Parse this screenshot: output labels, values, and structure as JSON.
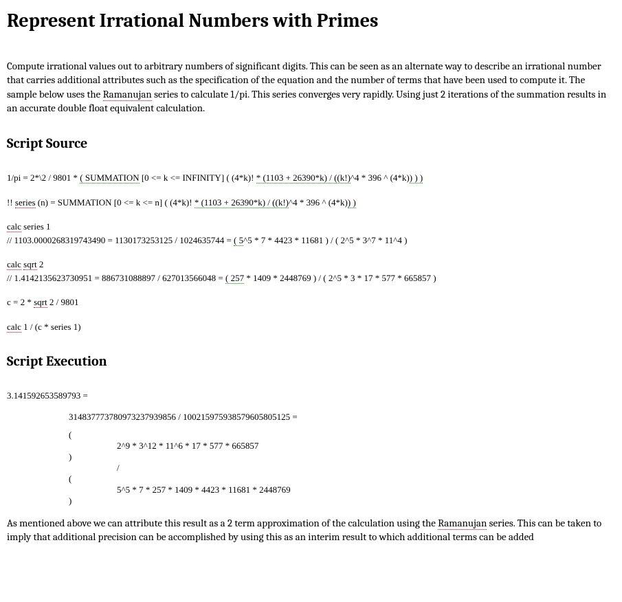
{
  "title": "Represent Irrational Numbers with Primes",
  "intro": {
    "part1": "Compute irrational values out to arbitrary numbers of significant digits.  This can be seen as an alternate way to describe an irrational number that carries additional attributes such as the specification of the equation and the number of terms that have been used to compute it.  The sample below uses the ",
    "link": "Ramanujan",
    "part2": " series to calculate 1/pi.  This series converges very rapidly.  Using just 2 iterations of the summation results in an accurate double float equivalent calculation."
  },
  "source_heading": "Script Source",
  "source": {
    "line1": {
      "a": "1/pi = 2*\\2 / 9801 * ",
      "b": "( SUMMATION",
      "c": " [0 <= k <= INFINITY] ( (4*k)! ",
      "d": "* (1103 + 26390*k) / ((k!)",
      "e": "^4 * 396 ^ (4*k)",
      "f": ") ) )"
    },
    "line2": {
      "a": "!! ",
      "b": "series",
      "c": " (n) = SUMMATION [0 <= k <= n] ( (4*k)! ",
      "d": "* (1103 + 26390*k) / ((k!)",
      "e": "^4 * 396 ^ (4*k)",
      "f": ") )"
    },
    "line3a": {
      "a": "calc",
      "b": " series 1"
    },
    "line3b": {
      "a": "// 1103.0000268319743490 = 1130173253125 / 1024635744 = ",
      "b": "( 5",
      "c": "^5 * 7 * 4423 * 11681 ) / ( 2^5 * 3^7 * 11^4 )"
    },
    "line4a": {
      "a": "calc",
      "b": " ",
      "c": "sqrt",
      "d": " 2"
    },
    "line4b": {
      "a": "// 1.4142135623730951 = 886731088897 / 627013566048 = ",
      "b": "( 257",
      "c": " * 1409 * 2448769 ) / ( 2^5 * 3 * 17 * 577 * 665857 )"
    },
    "line5": {
      "a": "c = 2 * ",
      "b": "sqrt",
      "c": " 2 / 9801"
    },
    "line6": {
      "a": "calc",
      "b": " 1 / (c * series 1)"
    }
  },
  "exec_heading": "Script Execution",
  "exec": {
    "result": "3.141592653589793 =",
    "fraction": "314837773780973237939856 / 100215975938579605805125 =",
    "open1": "(",
    "numerator": "2^9 * 3^12 * 11^6 * 17 * 577 * 665857",
    "close1": ")",
    "div": "/",
    "open2": "(",
    "denominator": "5^5 * 7 * 257 * 1409 * 4423 * 11681 * 2448769",
    "close2": ")"
  },
  "closing": {
    "a": "As mentioned above we can attribute this result as a 2 term approximation of the calculation using the ",
    "b": "Ramanujan",
    "c": " series.  This can be taken to imply that additional precision can be accomplished by using this as an interim result to which additional terms can be added"
  }
}
